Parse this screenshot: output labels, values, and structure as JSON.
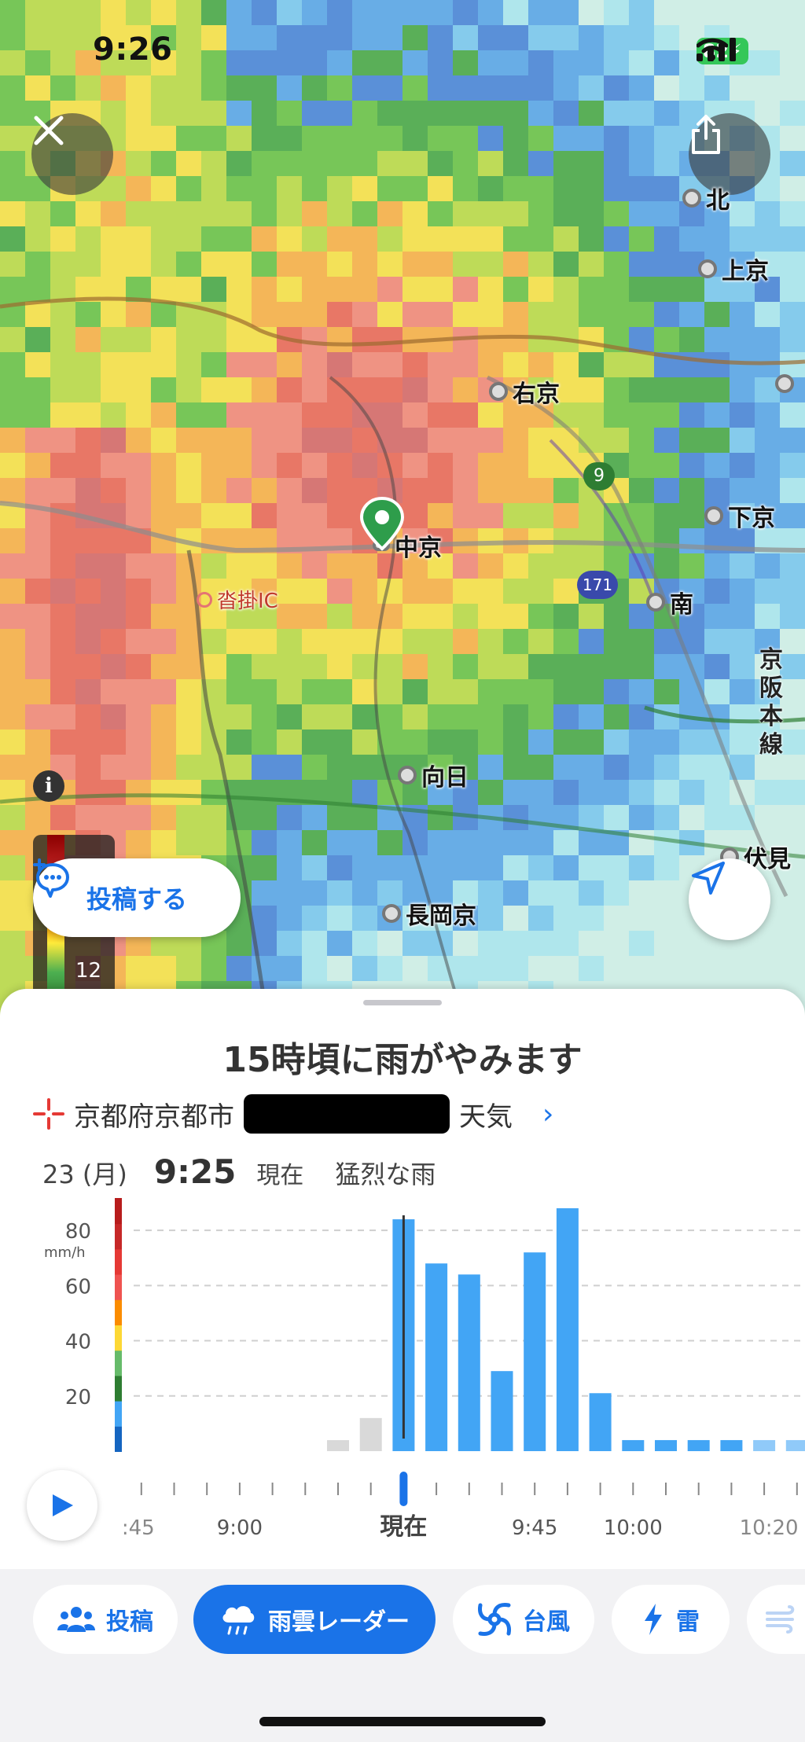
{
  "status": {
    "time": "9:26",
    "battery": "82"
  },
  "map": {
    "cities": [
      "北",
      "上京",
      "右京",
      "下京",
      "中京",
      "南",
      "向日",
      "長岡京",
      "伏見",
      "沓掛IC"
    ],
    "rail_label": "京阪本線",
    "route_numbers": [
      "9",
      "171"
    ],
    "legend_value": "12"
  },
  "buttons": {
    "post": "投稿する"
  },
  "sheet": {
    "headline": "15時頃に雨がやみます",
    "location_prefix": "京都府京都市",
    "location_suffix": "天気",
    "date": "23 (月)",
    "time": "9:25",
    "now_label": "現在",
    "condition": "猛烈な雨"
  },
  "chart_data": {
    "type": "bar",
    "ylabel": "mm/h",
    "y_ticks": [
      20,
      40,
      60,
      80
    ],
    "ylim": [
      0,
      90
    ],
    "grid": true,
    "times": [
      "8:45",
      "8:50",
      "8:55",
      "9:00",
      "9:05",
      "9:10",
      "9:15",
      "9:20",
      "9:25",
      "9:30",
      "9:35",
      "9:40",
      "9:45",
      "9:50",
      "9:55",
      "10:00",
      "10:05",
      "10:10",
      "10:15",
      "10:20",
      "10:25"
    ],
    "values": [
      0,
      0,
      0,
      0,
      0,
      0,
      4,
      12,
      84,
      68,
      64,
      29,
      72,
      88,
      21,
      4,
      4,
      4,
      4,
      4,
      4
    ],
    "past_count": 8,
    "current_index": 8,
    "x_tick_labels": [
      ":45",
      "9:00",
      "現在",
      "9:45",
      "10:00",
      "10:20"
    ],
    "colors": {
      "past": "#d9d9d9",
      "forecast": "#42a5f5",
      "now_line": "#333333",
      "now_marker": "#1a73e8"
    }
  },
  "tabs": [
    {
      "label": "投稿",
      "icon": "people-icon",
      "active": false
    },
    {
      "label": "雨雲レーダー",
      "icon": "rain-cloud-icon",
      "active": true
    },
    {
      "label": "台風",
      "icon": "typhoon-icon",
      "active": false
    },
    {
      "label": "雷",
      "icon": "lightning-icon",
      "active": false
    }
  ]
}
